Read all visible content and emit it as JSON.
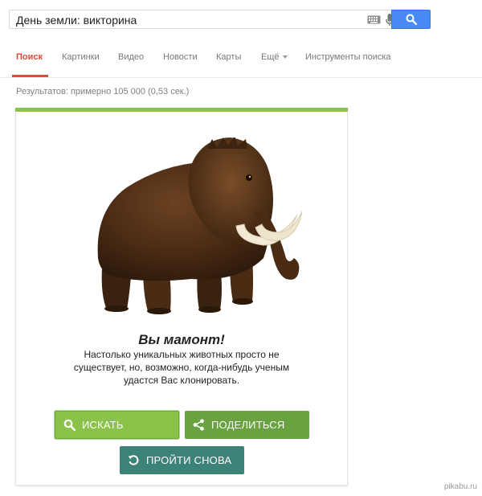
{
  "search": {
    "query": "День земли: викторина"
  },
  "tabs": [
    {
      "label": "Поиск",
      "active": true
    },
    {
      "label": "Картинки"
    },
    {
      "label": "Видео"
    },
    {
      "label": "Новости"
    },
    {
      "label": "Карты"
    },
    {
      "label": "Ещё"
    },
    {
      "label": "Инструменты поиска"
    }
  ],
  "result_stats": "Результатов: примерно 105 000 (0,53 сек.)",
  "quiz": {
    "accent_color": "#8bc34a",
    "image_icon": "mammoth-illustration",
    "title": "Вы мамонт!",
    "description": "Настолько уникальных животных просто не существует, но, возможно, когда-нибудь ученым удастся Вас клонировать.",
    "buttons": {
      "search": "ИСКАТЬ",
      "share": "ПОДЕЛИТЬСЯ",
      "retry": "ПРОЙТИ СНОВА"
    }
  },
  "watermark": "pikabu.ru"
}
